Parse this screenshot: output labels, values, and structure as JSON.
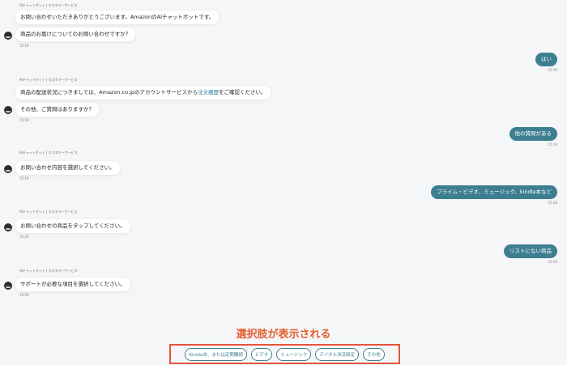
{
  "bot_label": "AIチャットボット | カスタマーサービス",
  "messages": {
    "m1a": "お問い合わせいただきありがとうございます。AmazonのAIチャットボットです。",
    "m1b": "商品のお届けについてのお問い合わせですか？",
    "t1": "15:19",
    "u1": "はい",
    "tu1": "15:19",
    "m2a_pre": "商品の配送状況につきましては、Amazon.co.jpのアカウントサービスから",
    "m2a_link": "注文履歴",
    "m2a_post": "をご確認ください。",
    "m2b": "その他、ご質問はありますか？",
    "t2": "15:19",
    "u2": "他の質問がある",
    "tu2": "15:19",
    "m3": "お問い合わせ内容を選択してください。",
    "t3": "15:19",
    "u3": "プライム・ビデオ、ミュージック、kindle本など",
    "tu3": "15:20",
    "m4": "お問い合わせの商品をタップしてください。",
    "t4": "15:20",
    "u4": "リストにない商品",
    "tu4": "15:20",
    "m5": "サポートが必要な項目を選択してください。",
    "t5": "15:20"
  },
  "caption": "選択肢が表示される",
  "choices": [
    "Kindle本、または定期購読",
    "ビデオ",
    "ミュージック",
    "デジタル決済設定",
    "その他"
  ],
  "colors": {
    "user_bubble": "#3d7f91",
    "caption": "#e65b2b",
    "highlight_border": "#e5533a"
  },
  "icons": {
    "bot_avatar": "bot-avatar-icon"
  }
}
